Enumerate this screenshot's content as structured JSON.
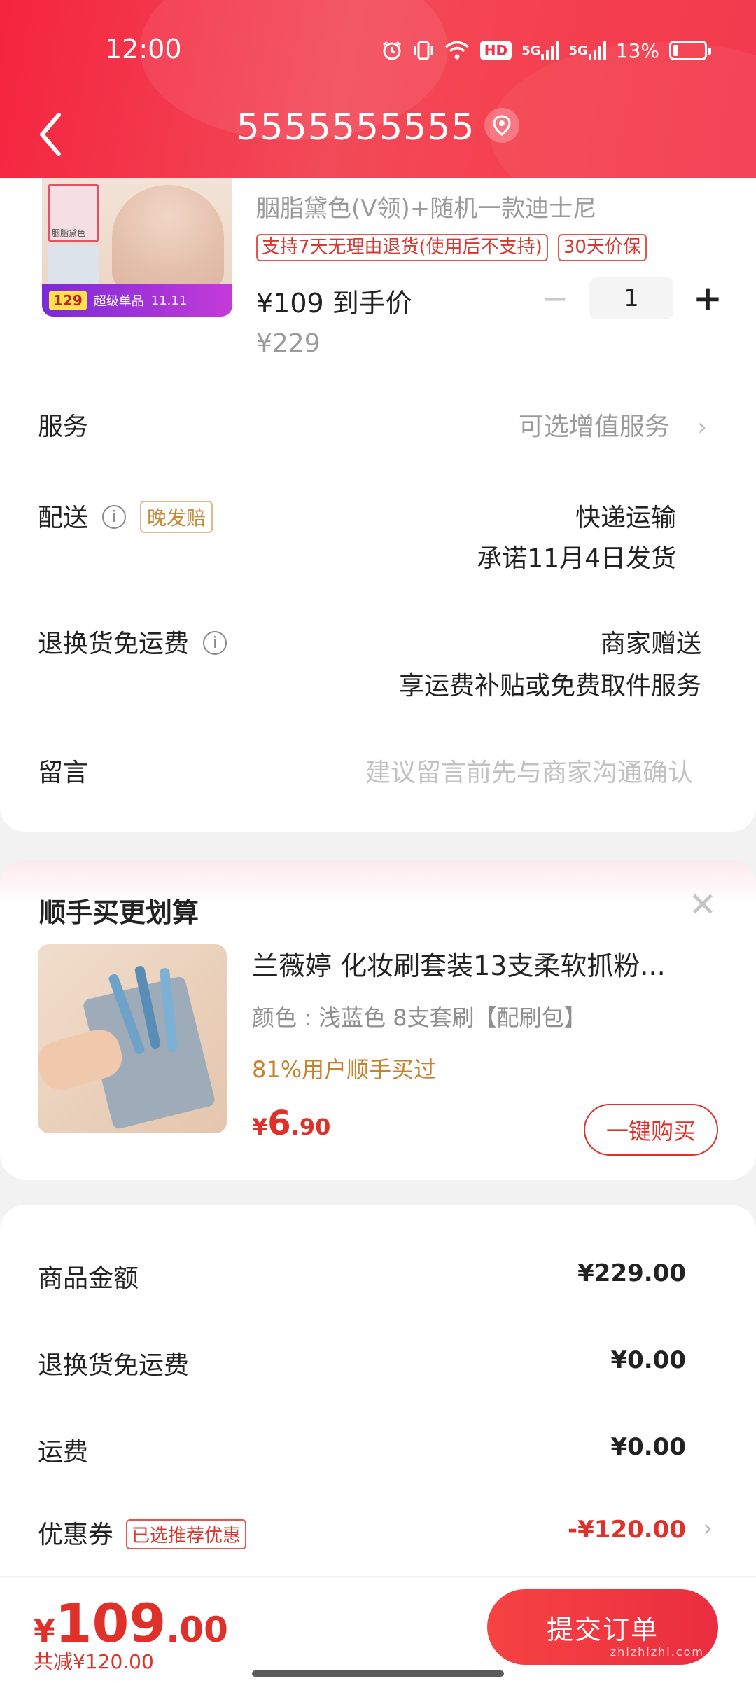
{
  "status_bar": {
    "time": "12:00",
    "hd_label": "HD",
    "net1": "5G",
    "net2": "5G",
    "battery": "13%"
  },
  "nav": {
    "title": "5555555555"
  },
  "product": {
    "variant": "胭脂黛色(V领)+随机一款迪士尼",
    "tags": [
      "支持7天无理由退货(使用后不支持)",
      "30天价保"
    ],
    "price_line": "¥109 到手价",
    "original_price": "¥229",
    "quantity": "1",
    "image_texts": {
      "thumb_label": "胭脂黛色",
      "badge_price": "129",
      "badge_text": "超级单品",
      "date": "11.11"
    }
  },
  "rows": {
    "service_label": "服务",
    "service_value": "可选增值服务",
    "delivery_label": "配送",
    "delivery_tag": "晚发赔",
    "delivery_value1": "快递运输",
    "delivery_value2": "承诺11月4日发货",
    "return_label": "退换货免运费",
    "return_value1": "商家赠送",
    "return_value2": "享运费补贴或免费取件服务",
    "message_label": "留言",
    "message_placeholder": "建议留言前先与商家沟通确认"
  },
  "upsell": {
    "title": "顺手买更划算",
    "name": "兰薇婷 化妆刷套装13支柔软抓粉...",
    "color": "颜色 : 浅蓝色 8支套刷【配刷包】",
    "rate": "81%用户顺手买过",
    "price_symbol": "¥",
    "price_int": "6",
    "price_dec": ".90",
    "buy_label": "一键购买"
  },
  "summary": {
    "goods_label": "商品金额",
    "goods_value": "¥229.00",
    "return_label": "退换货免运费",
    "return_value": "¥0.00",
    "shipping_label": "运费",
    "shipping_value": "¥0.00",
    "coupon_label": "优惠券",
    "coupon_tag": "已选推荐优惠",
    "coupon_value": "-¥120.00"
  },
  "bottom": {
    "total_symbol": "¥",
    "total_int": "109",
    "total_dec": ".00",
    "saved": "共减¥120.00",
    "submit_label": "提交订单",
    "watermark": "zhizhizhi.com"
  },
  "colors": {
    "brand_red": "#f2304a",
    "price_red": "#e0302a",
    "warn_orange": "#c7822c"
  }
}
